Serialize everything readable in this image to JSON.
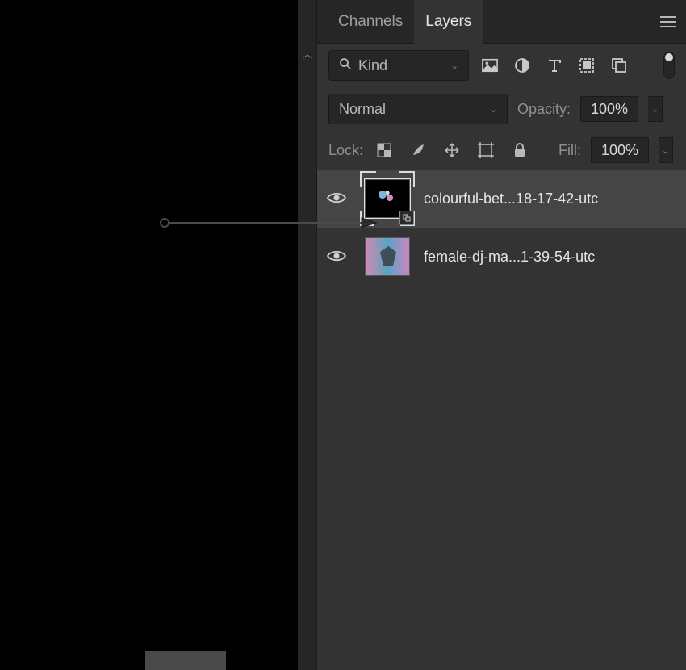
{
  "tabs": {
    "channels": "Channels",
    "layers": "Layers"
  },
  "filter": {
    "label": "Kind"
  },
  "blend": {
    "mode": "Normal",
    "opacity_label": "Opacity:",
    "opacity_value": "100%"
  },
  "lock": {
    "label": "Lock:",
    "fill_label": "Fill:",
    "fill_value": "100%"
  },
  "layers": [
    {
      "name": "colourful-bet...18-17-42-utc",
      "selected": true,
      "smart": true
    },
    {
      "name": "female-dj-ma...1-39-54-utc",
      "selected": false,
      "smart": false
    }
  ]
}
